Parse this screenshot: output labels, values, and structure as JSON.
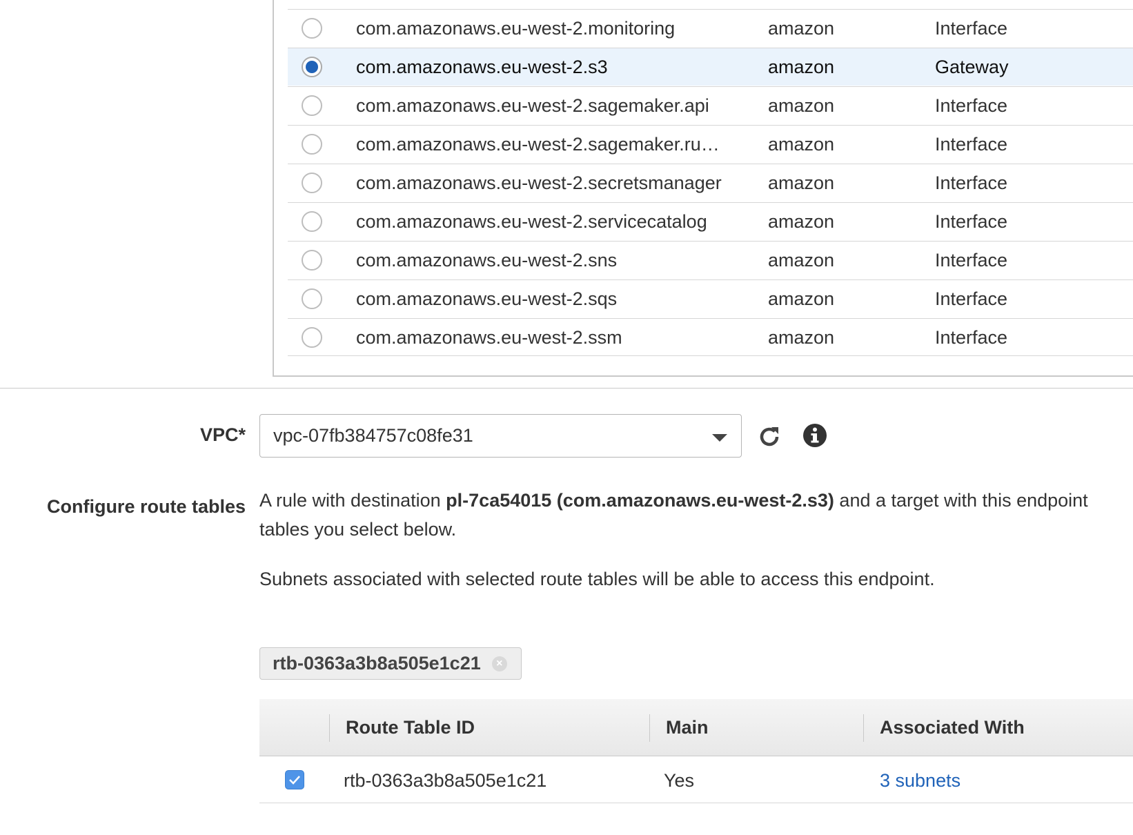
{
  "services": {
    "rows": [
      {
        "name": "com.amazonaws.eu-west-2.monitoring",
        "owner": "amazon",
        "type": "Interface",
        "selected": false
      },
      {
        "name": "com.amazonaws.eu-west-2.s3",
        "owner": "amazon",
        "type": "Gateway",
        "selected": true
      },
      {
        "name": "com.amazonaws.eu-west-2.sagemaker.api",
        "owner": "amazon",
        "type": "Interface",
        "selected": false
      },
      {
        "name": "com.amazonaws.eu-west-2.sagemaker.ru…",
        "owner": "amazon",
        "type": "Interface",
        "selected": false
      },
      {
        "name": "com.amazonaws.eu-west-2.secretsmanager",
        "owner": "amazon",
        "type": "Interface",
        "selected": false
      },
      {
        "name": "com.amazonaws.eu-west-2.servicecatalog",
        "owner": "amazon",
        "type": "Interface",
        "selected": false
      },
      {
        "name": "com.amazonaws.eu-west-2.sns",
        "owner": "amazon",
        "type": "Interface",
        "selected": false
      },
      {
        "name": "com.amazonaws.eu-west-2.sqs",
        "owner": "amazon",
        "type": "Interface",
        "selected": false
      },
      {
        "name": "com.amazonaws.eu-west-2.ssm",
        "owner": "amazon",
        "type": "Interface",
        "selected": false
      }
    ]
  },
  "vpc": {
    "label": "VPC*",
    "value": "vpc-07fb384757c08fe31",
    "refresh_icon": "refresh-icon",
    "info_icon": "info-icon"
  },
  "route_tables": {
    "label": "Configure route tables",
    "desc_pre": "A rule with destination ",
    "desc_bold": "pl-7ca54015 (com.amazonaws.eu-west-2.s3)",
    "desc_post": " and a target with this endpoint",
    "desc_line2": "tables you select below.",
    "desc_subnets": "Subnets associated with selected route tables will be able to access this endpoint.",
    "token": "rtb-0363a3b8a505e1c21",
    "columns": [
      "Route Table ID",
      "Main",
      "Associated With"
    ],
    "rows": [
      {
        "id": "rtb-0363a3b8a505e1c21",
        "main": "Yes",
        "associated": "3 subnets",
        "checked": true
      }
    ]
  },
  "colors": {
    "selected_row_bg": "#eaf3fc",
    "accent": "#1f62b8",
    "checkbox": "#4e94e8"
  }
}
